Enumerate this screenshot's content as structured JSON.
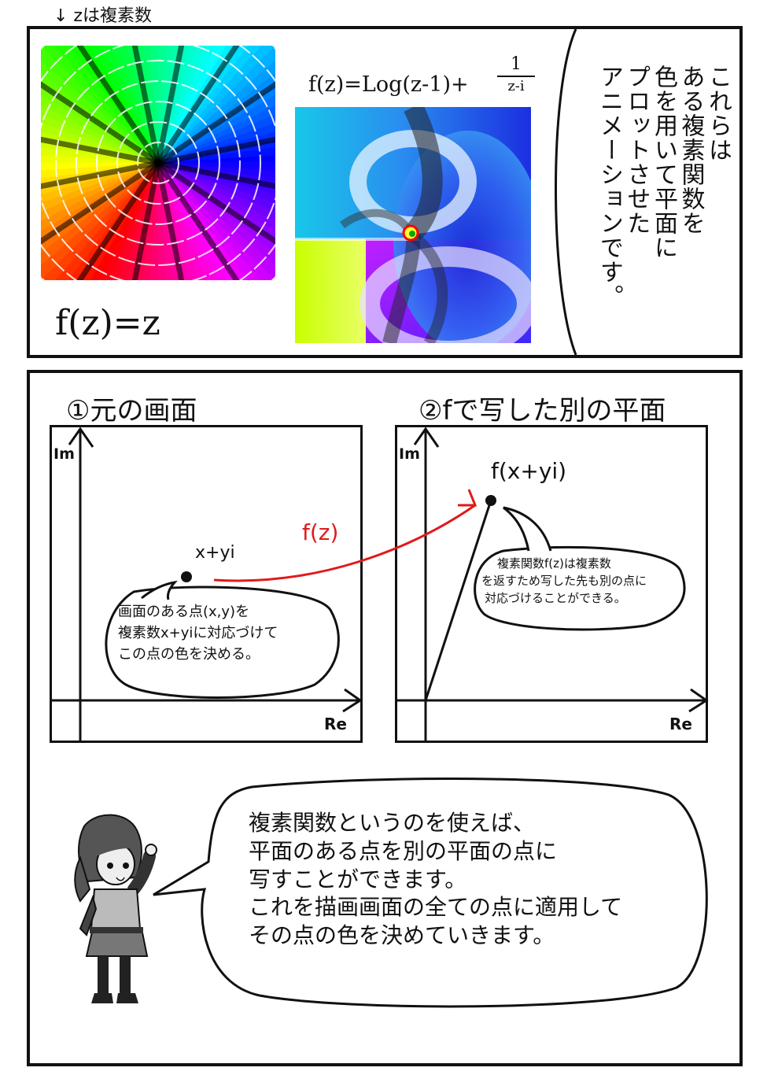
{
  "top_note": "↓ zは複素数",
  "panel1": {
    "formula_identity": "f(z)=z",
    "formula_log": "f(z)=Log(z-1)+",
    "formula_log_numerator": "1",
    "formula_log_denominator": "z-i",
    "narration_lines": [
      "これらは",
      "ある複素関数を",
      "色を用いて平面に",
      "プロットさせた",
      "アニメーションです。"
    ]
  },
  "panel2": {
    "title_left": "①元の画面",
    "title_right": "②fで写した別の平面",
    "axis_im": "Im",
    "axis_re": "Re",
    "point_label_left": "x+yi",
    "arrow_label": "f(z)",
    "point_label_right": "f(x+yi)",
    "bubble_left_lines": [
      "画面のある点(x,y)を",
      "複素数x+yiに対応づけて",
      "この点の色を決める。"
    ],
    "bubble_right_lines": [
      "複素関数f(z)は複素数",
      "を返すため写した先も別の点に",
      "対応づけることができる。"
    ],
    "speech_lines": [
      "複素関数というのを使えば、",
      "平面のある点を別の平面の点に",
      "写すことができます。",
      "これを描画画面の全ての点に適用して",
      "その点の色を決めていきます。"
    ]
  },
  "colors": {
    "ink": "#111111",
    "arrow": "#e01a1a"
  }
}
